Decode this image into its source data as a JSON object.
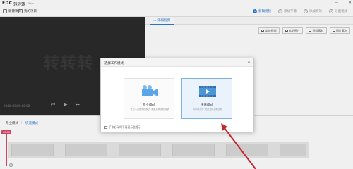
{
  "app": {
    "logo": "EDC",
    "name": "转转转",
    "version": "Beta"
  },
  "window_controls": [
    "—",
    "□",
    "✕"
  ],
  "toolbar": {
    "new_project": "新建项目",
    "my_projects": "我的项目",
    "steps": [
      {
        "num": "1",
        "label": "剪辑视频"
      },
      {
        "num": "2",
        "label": "添加字幕"
      },
      {
        "num": "3",
        "label": "添加特效"
      },
      {
        "num": "4",
        "label": "导出视频"
      }
    ]
  },
  "preview": {
    "watermark": "转转转",
    "timecode": "00:00:00/00:00:00"
  },
  "right_panel": {
    "tab_label": "添加视频",
    "actions": [
      "本地视频",
      "本地图片",
      "视频素材",
      "图片素材"
    ]
  },
  "modebar": {
    "pro": "专业模式",
    "separator": "|",
    "fast": "快速模式"
  },
  "timeline": {
    "marker": "00:00"
  },
  "dialog": {
    "title": "选择工作模式",
    "close": "✕",
    "cards": [
      {
        "label": "专业模式",
        "desc": "专业人员使用的模式 满足各种剪辑需求",
        "selected": false
      },
      {
        "label": "快速模式",
        "desc": "简单好操作 快速完成视频剪辑",
        "selected": true
      }
    ],
    "footer": "下次启动时不再显示此提示"
  },
  "colors": {
    "accent": "#2b7cd3",
    "marker": "#d94a6b",
    "arrow": "#c4272d",
    "preview_bg": "#2b2b2b"
  }
}
